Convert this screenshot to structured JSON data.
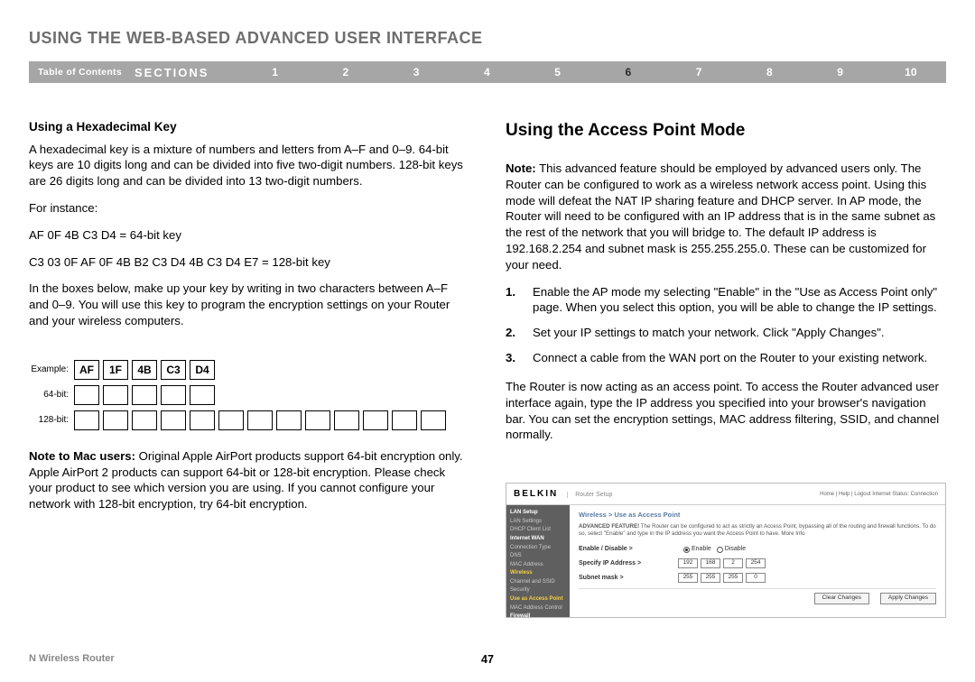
{
  "title": "USING THE WEB-BASED ADVANCED USER INTERFACE",
  "nav": {
    "toc": "Table of Contents",
    "sections_label": "SECTIONS",
    "items": [
      "1",
      "2",
      "3",
      "4",
      "5",
      "6",
      "7",
      "8",
      "9",
      "10"
    ],
    "active_index": 5
  },
  "left": {
    "hex_head": "Using a Hexadecimal Key",
    "hex_p1": "A hexadecimal key is a mixture of numbers and letters from A–F and 0–9. 64-bit keys are 10 digits long and can be divided into five two-digit numbers. 128-bit keys are 26 digits long and can be divided into 13 two-digit numbers.",
    "for_instance": "For instance:",
    "ex64": "AF 0F 4B C3 D4 = 64-bit key",
    "ex128": "C3 03 0F AF 0F 4B B2 C3 D4 4B C3 D4 E7 = 128-bit key",
    "instruct": "In the boxes below, make up your key by writing in two characters between A–F and 0–9. You will use this key to program the encryption settings on your Router and your wireless computers.",
    "example_label": "Example:",
    "example_cells": [
      "AF",
      "1F",
      "4B",
      "C3",
      "D4"
    ],
    "row64_label": "64-bit:",
    "row128_label": "128-bit:",
    "mac_note_bold": "Note to Mac users:",
    "mac_note": " Original Apple AirPort products support 64-bit encryption only. Apple AirPort 2 products can support 64-bit or 128-bit encryption. Please check your product to see which version you are using. If you cannot configure your network with 128-bit encryption, try 64-bit encryption."
  },
  "right": {
    "head": "Using the Access Point Mode",
    "note_bold": "Note:",
    "note": " This advanced feature should be employed by advanced users only. The Router can be configured to work as a wireless network access point. Using this mode will defeat the NAT IP sharing feature and DHCP server. In AP mode, the Router will need to be configured with an IP address that is in the same subnet as the rest of the network that you will bridge to. The default IP address is 192.168.2.254 and subnet mask is 255.255.255.0. These can be customized for your need.",
    "steps": [
      {
        "n": "1.",
        "t": "Enable the AP mode my selecting \"Enable\" in the \"Use as Access Point only\" page. When you select this option, you will be able to change the IP settings."
      },
      {
        "n": "2.",
        "t": "Set your IP settings to match your network. Click \"Apply Changes\"."
      },
      {
        "n": "3.",
        "t": "Connect a cable from the WAN port on the Router to your existing network."
      }
    ],
    "after": "The Router is now acting as an access point. To access the Router advanced user interface again, type the IP address you specified into your browser's navigation bar. You can set the encryption settings, MAC address filtering, SSID, and channel normally."
  },
  "router": {
    "brand": "BELKIN",
    "setup": "Router Setup",
    "links": "Home | Help | Logout   Internet Status: Connection",
    "side": {
      "lan": "LAN Setup",
      "lan1": "LAN Settings",
      "lan2": "DHCP Client List",
      "wan": "Internet WAN",
      "wan1": "Connection Type",
      "wan2": "DNS",
      "wan3": "MAC Address",
      "wl": "Wireless",
      "wl1": "Channel and SSID",
      "wl2": "Security",
      "wl3": "Use as Access Point",
      "wl4": "MAC Address Control",
      "fw": "Firewall"
    },
    "crumb": "Wireless > Use as Access Point",
    "adv_bold": "ADVANCED FEATURE!",
    "adv_text": " The Router can be configured to act as strictly an Access Point, bypassing all of the routing and firewall functions. To do so, select \"Enable\" and type in the IP address you want the Access Point to have. More Info",
    "row_enable": "Enable / Disable >",
    "opt_enable": "Enable",
    "opt_disable": "Disable",
    "row_ip": "Specify IP Address >",
    "ip": [
      "192",
      "168",
      "2",
      "254"
    ],
    "row_mask": "Subnet mask >",
    "mask": [
      "255",
      "255",
      "255",
      "0"
    ],
    "btn_clear": "Clear Changes",
    "btn_apply": "Apply Changes"
  },
  "footer": {
    "product": "N Wireless Router",
    "page": "47"
  }
}
